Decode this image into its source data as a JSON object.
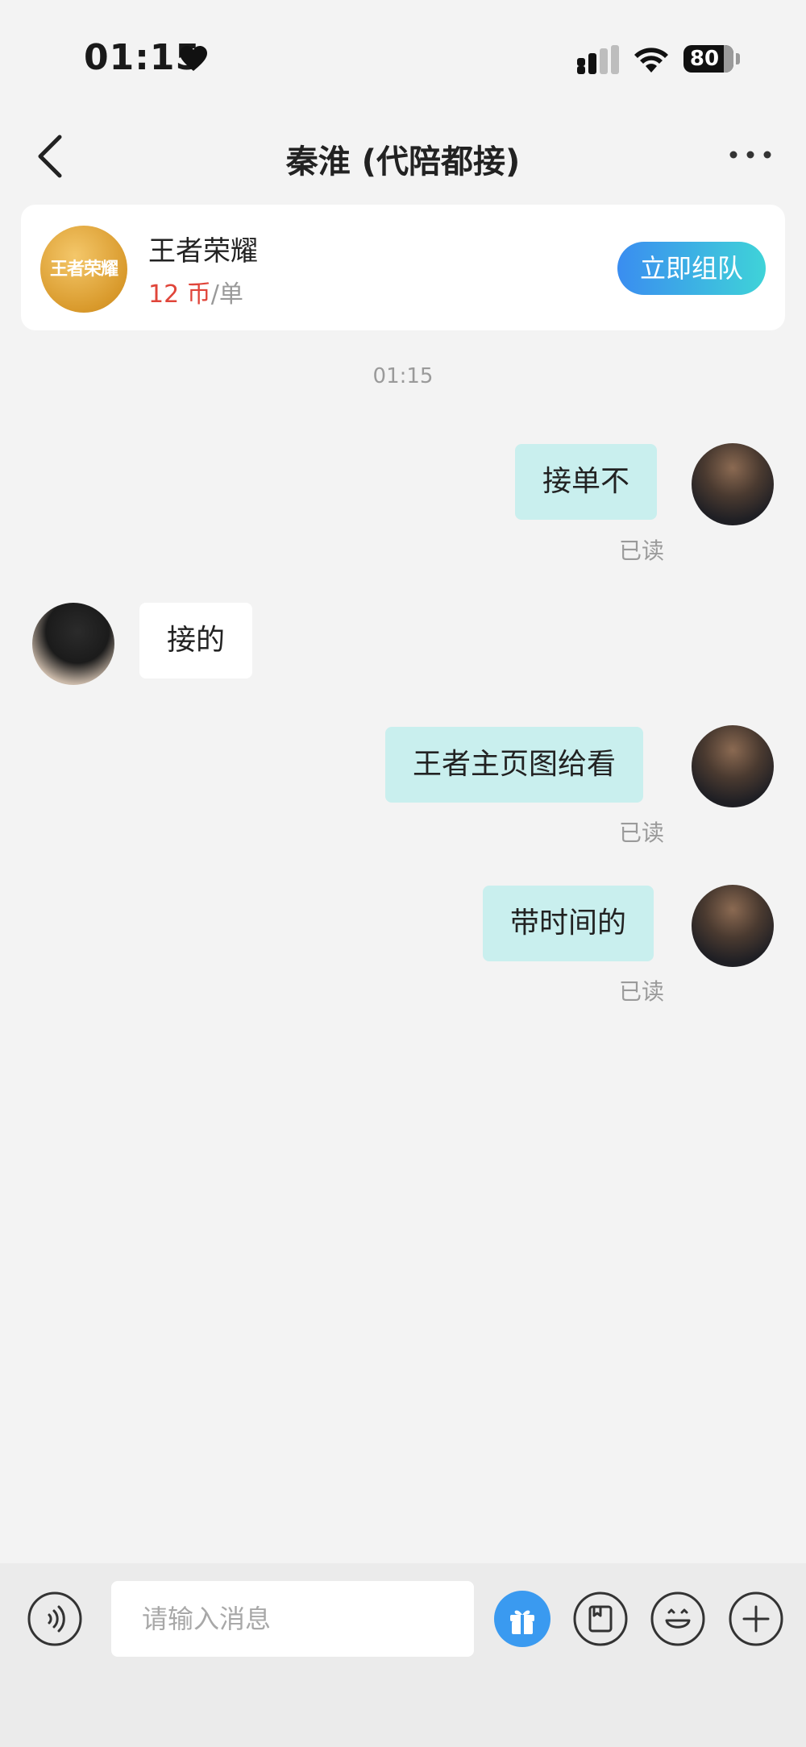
{
  "status_bar": {
    "time": "01:15",
    "battery": "80",
    "battery_level": 0.8
  },
  "nav": {
    "title": "秦淮 (代陪都接)"
  },
  "game_card": {
    "logo_text": "王者荣耀",
    "name": "王者荣耀",
    "price_value": "12 币",
    "price_unit": "/单",
    "button_label": "立即组队"
  },
  "chat": {
    "timestamp": "01:15",
    "messages": [
      {
        "sender": "me",
        "text": "接单不",
        "status": "已读"
      },
      {
        "sender": "other",
        "text": "接的"
      },
      {
        "sender": "me",
        "text": "王者主页图给看",
        "status": "已读"
      },
      {
        "sender": "me",
        "text": "带时间的",
        "status": "已读"
      }
    ]
  },
  "input_bar": {
    "placeholder": "请输入消息",
    "icons": [
      "voice-icon",
      "gift-icon",
      "order-card-icon",
      "emoji-icon",
      "plus-icon"
    ],
    "gift_color": "#3a9af0"
  }
}
